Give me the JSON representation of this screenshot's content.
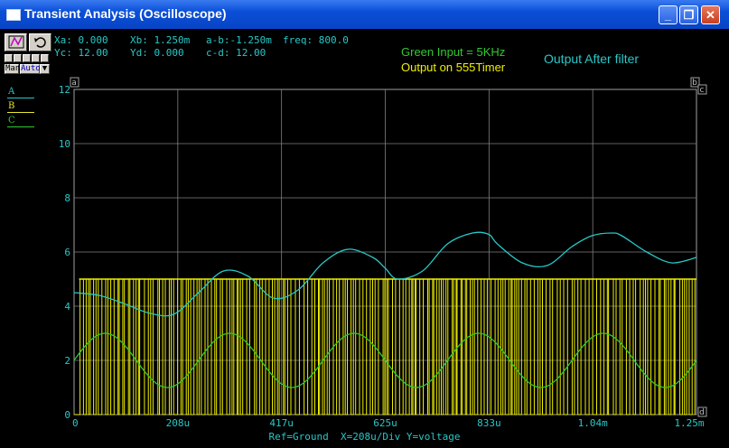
{
  "window": {
    "title": "Transient Analysis (Oscilloscope)",
    "controls": {
      "minimize": "_",
      "maximize": "❐",
      "close": "✕"
    }
  },
  "toolbar": {
    "cursor_icon": "cursor-icon",
    "undo_icon": "undo-icon",
    "manual_label": "Man",
    "auto_label": "Auto"
  },
  "readouts": {
    "xa": "Xa: 0.000",
    "xb": "Xb: 1.250m",
    "ab": "a-b:-1.250m",
    "freq": "freq: 800.0",
    "yc": "Yc: 12.00",
    "yd": "Yd: 0.000",
    "cd": "c-d: 12.00"
  },
  "annotations": {
    "green_input": "Green Input = 5KHz",
    "output_555": "Output on 555Timer",
    "output_filter": "Output After filter"
  },
  "legend": [
    {
      "label": "A",
      "color": "#28c8c8"
    },
    {
      "label": "B",
      "color": "#e8e830"
    },
    {
      "label": "C",
      "color": "#30c830"
    }
  ],
  "cursors": {
    "a": "a",
    "b": "b",
    "c": "c",
    "d": "d"
  },
  "footer": "Ref=Ground  X=208u/Div Y=voltage",
  "colors": {
    "cyan": "#28c8c8",
    "yellow": "#f0f000",
    "green": "#30c830",
    "grid": "#808080"
  },
  "chart_data": {
    "type": "line",
    "title": "",
    "xlabel": "",
    "ylabel": "",
    "xlim": [
      0,
      1.25
    ],
    "ylim": [
      0,
      12
    ],
    "grid": true,
    "x_ticks": [
      "0",
      "208u",
      "417u",
      "625u",
      "833u",
      "1.04m",
      "1.25m"
    ],
    "y_ticks": [
      "0",
      "2",
      "4",
      "6",
      "8",
      "10",
      "12"
    ],
    "series": [
      {
        "name": "A",
        "color": "#28c8c8",
        "x": [
          0,
          0.05,
          0.1,
          0.15,
          0.2,
          0.25,
          0.3,
          0.35,
          0.4,
          0.45,
          0.5,
          0.55,
          0.6,
          0.625,
          0.65,
          0.7,
          0.75,
          0.8,
          0.833,
          0.85,
          0.9,
          0.95,
          1.0,
          1.04,
          1.08,
          1.1,
          1.15,
          1.2,
          1.25
        ],
        "values": [
          4.5,
          4.4,
          4.1,
          3.75,
          3.7,
          4.5,
          5.3,
          5.1,
          4.3,
          4.6,
          5.6,
          6.1,
          5.8,
          5.4,
          5.0,
          5.3,
          6.3,
          6.7,
          6.65,
          6.3,
          5.6,
          5.5,
          6.2,
          6.6,
          6.7,
          6.6,
          6.0,
          5.6,
          5.8
        ]
      },
      {
        "name": "C",
        "color": "#30c830",
        "period": 0.25,
        "offset": 2.0,
        "amplitude": 1.0,
        "phase_peak_x": 0.0625
      },
      {
        "name": "B",
        "color": "#f0f000",
        "high": 5.0,
        "low": 0.0,
        "description_pulses": true
      }
    ]
  }
}
